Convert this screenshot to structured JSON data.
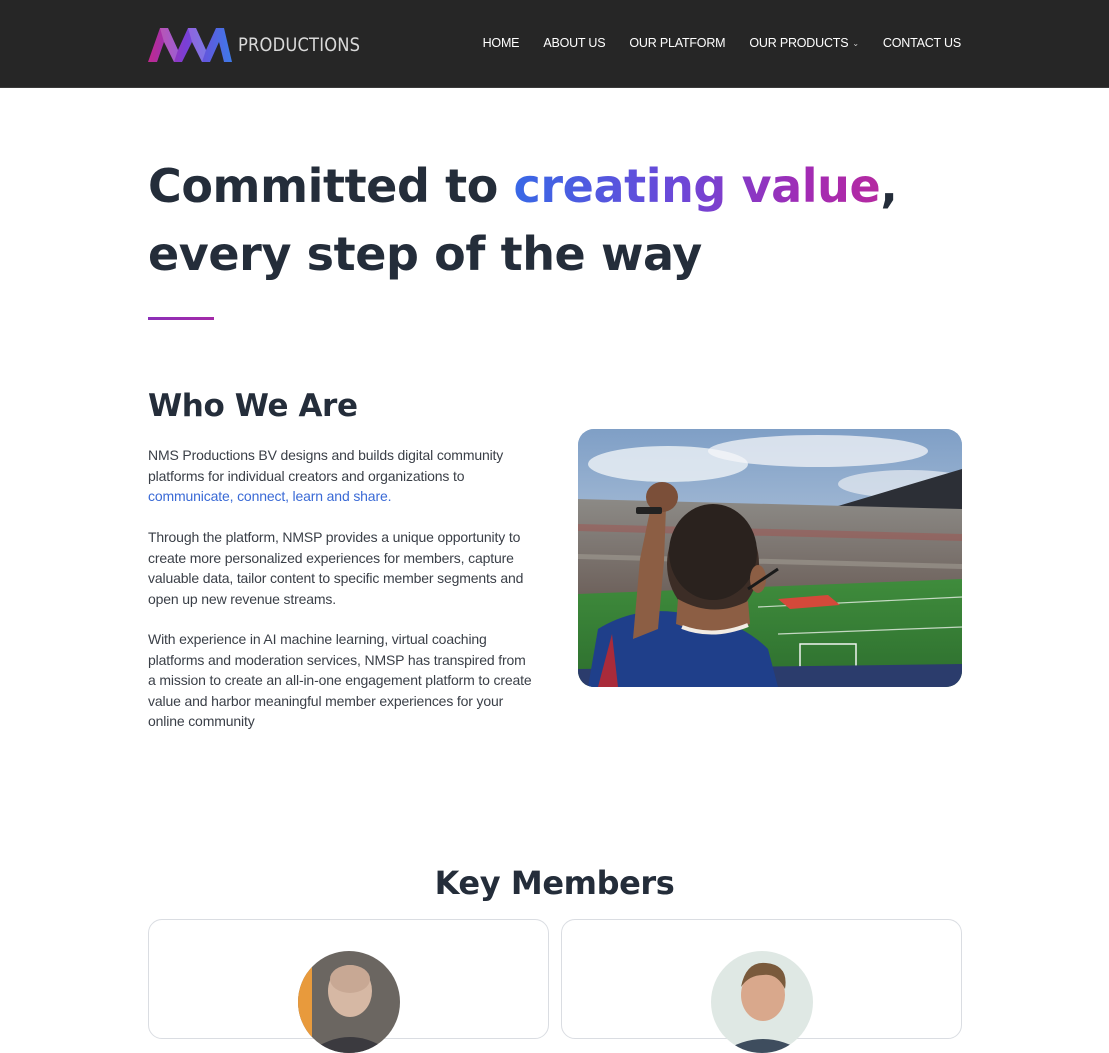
{
  "header": {
    "logo_text": "PRODUCTIONS",
    "nav": [
      {
        "label": "HOME"
      },
      {
        "label": "ABOUT US"
      },
      {
        "label": "OUR PLATFORM"
      },
      {
        "label": "OUR PRODUCTS",
        "has_dropdown": true
      },
      {
        "label": "CONTACT US"
      }
    ]
  },
  "hero": {
    "line1_prefix": "Committed to ",
    "line1_highlight": "creating value",
    "line1_suffix": ",",
    "line2": "every step of the way"
  },
  "who_we_are": {
    "title": "Who We Are",
    "p1_text": "NMS Productions BV designs and builds digital community platforms for individual creators and organizations to ",
    "p1_link": "communicate, connect, learn and share.",
    "p2": "Through the platform, NMSP provides a unique opportunity to create more personalized  experiences for members, capture valuable data, tailor content to specific member segments and open up new revenue streams.",
    "p3": "With experience in AI machine learning, virtual coaching platforms and moderation services, NMSP has transpired from a mission to create an all-in-one engagement platform to create value and harbor meaningful member experiences for your online community"
  },
  "key_members": {
    "title": "Key Members"
  },
  "colors": {
    "header_bg": "#262626",
    "heading": "#242d3a",
    "gradient_start": "#3868e6",
    "gradient_end": "#b52aa0",
    "link": "#3a6ad6"
  }
}
